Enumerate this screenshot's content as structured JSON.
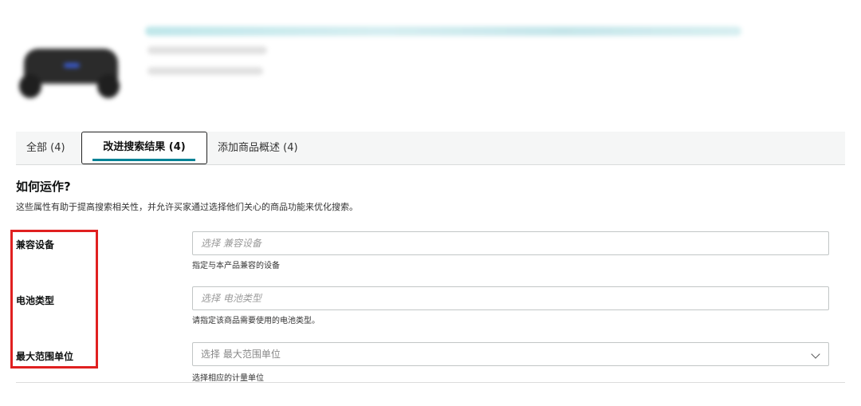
{
  "tabs": [
    {
      "label": "全部 (4)",
      "active": false
    },
    {
      "label": "改进搜索结果 (4)",
      "active": true
    },
    {
      "label": "添加商品概述 (4)",
      "active": false
    }
  ],
  "section": {
    "title": "如何运作?",
    "description": "这些属性有助于提高搜索相关性，并允许买家通过选择他们关心的商品功能来优化搜索。"
  },
  "fields": [
    {
      "label": "兼容设备",
      "placeholder": "选择 兼容设备",
      "help": "指定与本产品兼容的设备",
      "type": "text"
    },
    {
      "label": "电池类型",
      "placeholder": "选择 电池类型",
      "help": "请指定该商品需要使用的电池类型。",
      "type": "text"
    },
    {
      "label": "最大范围单位",
      "placeholder": "选择 最大范围单位",
      "help": "选择相应的计量单位",
      "type": "select"
    }
  ],
  "colors": {
    "accent": "#008296",
    "highlight": "#e02020"
  },
  "icons": {
    "dropdown": "chevron-down-icon"
  }
}
